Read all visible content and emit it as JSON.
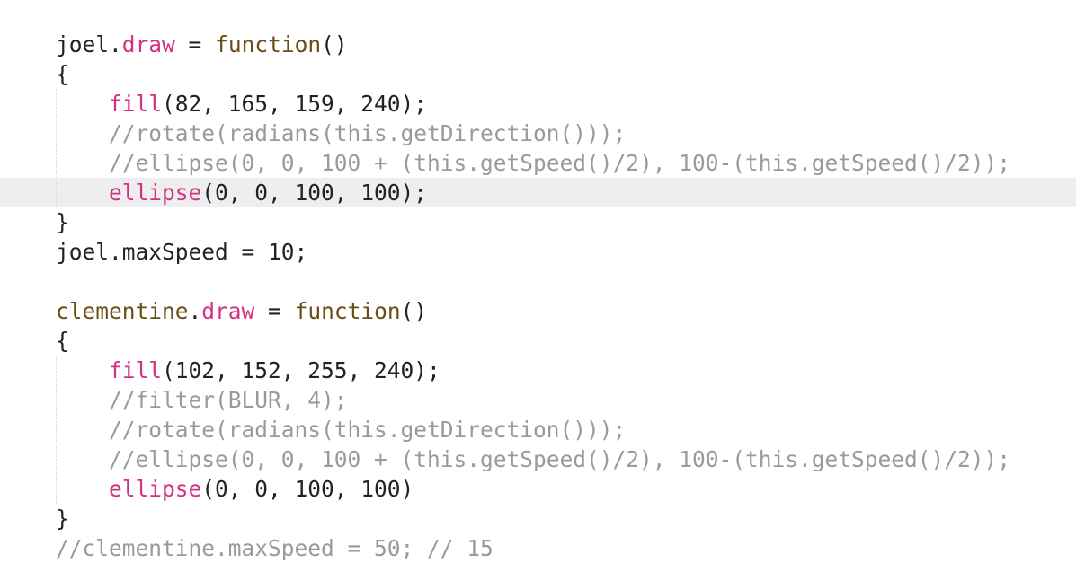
{
  "editor": {
    "current_line_index": 5,
    "colors": {
      "background": "#ffffff",
      "current_line": "#eeeeee",
      "identifier": "#222222",
      "property_and_builtin": "#d43183",
      "keyword": "#6b4e16",
      "comment": "#9a9a9a",
      "indent_guide": "#d6d6d6"
    },
    "lines": [
      {
        "tokens": [
          {
            "t": "joel",
            "c": "id"
          },
          {
            "t": ".",
            "c": "pun"
          },
          {
            "t": "draw",
            "c": "prop"
          },
          {
            "t": " = ",
            "c": "pun"
          },
          {
            "t": "function",
            "c": "kw"
          },
          {
            "t": "()",
            "c": "pun"
          }
        ]
      },
      {
        "tokens": [
          {
            "t": "{",
            "c": "pun"
          }
        ]
      },
      {
        "tokens": [
          {
            "t": "    ",
            "c": "pun"
          },
          {
            "t": "fill",
            "c": "fn"
          },
          {
            "t": "(82, 165, 159, 240);",
            "c": "pun"
          }
        ]
      },
      {
        "tokens": [
          {
            "t": "    ",
            "c": "pun"
          },
          {
            "t": "//rotate(radians(this.getDirection()));",
            "c": "cmt"
          }
        ]
      },
      {
        "tokens": [
          {
            "t": "    ",
            "c": "pun"
          },
          {
            "t": "//ellipse(0, 0, 100 + (this.getSpeed()/2), 100-(this.getSpeed()/2));",
            "c": "cmt"
          }
        ]
      },
      {
        "tokens": [
          {
            "t": "    ",
            "c": "pun"
          },
          {
            "t": "ellipse",
            "c": "fn"
          },
          {
            "t": "(0, 0, 100, 100);",
            "c": "pun"
          }
        ]
      },
      {
        "tokens": [
          {
            "t": "}",
            "c": "pun"
          }
        ]
      },
      {
        "tokens": [
          {
            "t": "joel",
            "c": "id"
          },
          {
            "t": ".maxSpeed = 10;",
            "c": "pun"
          }
        ]
      },
      {
        "tokens": []
      },
      {
        "tokens": [
          {
            "t": "clementine",
            "c": "kw"
          },
          {
            "t": ".",
            "c": "pun"
          },
          {
            "t": "draw",
            "c": "prop"
          },
          {
            "t": " = ",
            "c": "pun"
          },
          {
            "t": "function",
            "c": "kw"
          },
          {
            "t": "()",
            "c": "pun"
          }
        ]
      },
      {
        "tokens": [
          {
            "t": "{",
            "c": "pun"
          }
        ]
      },
      {
        "tokens": [
          {
            "t": "    ",
            "c": "pun"
          },
          {
            "t": "fill",
            "c": "fn"
          },
          {
            "t": "(102, 152, 255, 240);",
            "c": "pun"
          }
        ]
      },
      {
        "tokens": [
          {
            "t": "    ",
            "c": "pun"
          },
          {
            "t": "//filter(BLUR, 4);",
            "c": "cmt"
          }
        ]
      },
      {
        "tokens": [
          {
            "t": "    ",
            "c": "pun"
          },
          {
            "t": "//rotate(radians(this.getDirection()));",
            "c": "cmt"
          }
        ]
      },
      {
        "tokens": [
          {
            "t": "    ",
            "c": "pun"
          },
          {
            "t": "//ellipse(0, 0, 100 + (this.getSpeed()/2), 100-(this.getSpeed()/2));",
            "c": "cmt"
          }
        ]
      },
      {
        "tokens": [
          {
            "t": "    ",
            "c": "pun"
          },
          {
            "t": "ellipse",
            "c": "fn"
          },
          {
            "t": "(0, 0, 100, 100)",
            "c": "pun"
          }
        ]
      },
      {
        "tokens": [
          {
            "t": "}",
            "c": "pun"
          }
        ]
      },
      {
        "tokens": [
          {
            "t": "//clementine.maxSpeed = 50; // 15",
            "c": "cmt"
          }
        ]
      }
    ]
  }
}
